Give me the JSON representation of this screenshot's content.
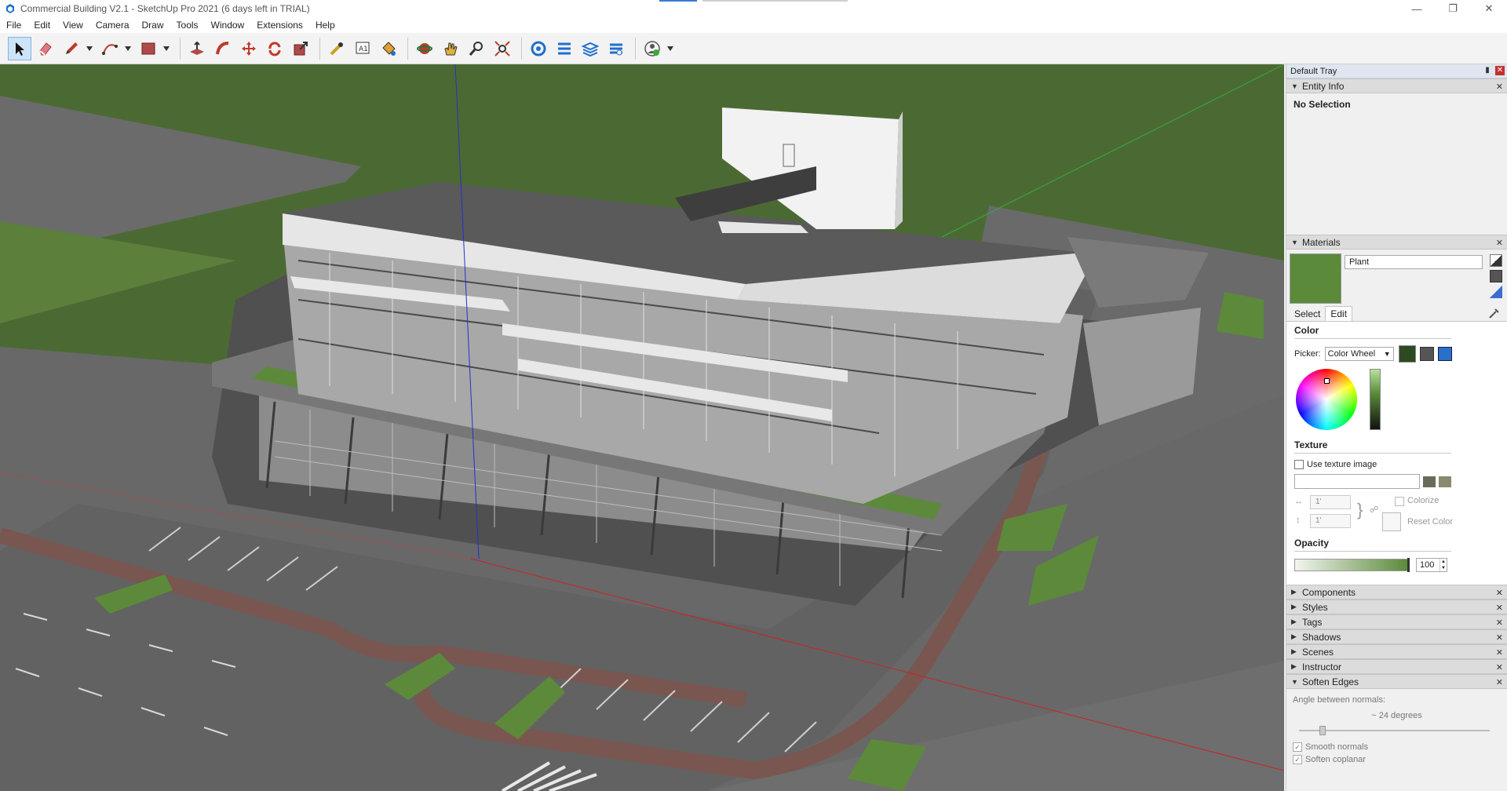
{
  "window": {
    "title": "Commercial Building V2.1 - SketchUp Pro 2021 (6 days left in TRIAL)",
    "controls": [
      "minimize",
      "restore",
      "close"
    ]
  },
  "menu": [
    "File",
    "Edit",
    "View",
    "Camera",
    "Draw",
    "Tools",
    "Window",
    "Extensions",
    "Help"
  ],
  "toolbar": {
    "tools": [
      "select",
      "eraser",
      "line",
      "arc",
      "rectangle",
      "push-pull",
      "follow-me",
      "move",
      "rotate",
      "scale",
      "tape-measure",
      "text",
      "paint-bucket",
      "orbit",
      "pan",
      "zoom",
      "zoom-extents",
      "warehouse",
      "extension-warehouse",
      "layout",
      "extension-manager",
      "profile"
    ]
  },
  "tray": {
    "title": "Default Tray",
    "entity_info": {
      "title": "Entity Info",
      "status": "No Selection"
    },
    "materials": {
      "title": "Materials",
      "name": "Plant",
      "swatch_color": "#5a8a3a",
      "tabs": [
        "Select",
        "Edit"
      ],
      "selected_tab": "Edit",
      "color_section": "Color",
      "picker_label": "Picker:",
      "picker_value": "Color Wheel",
      "texture_section": "Texture",
      "use_texture_label": "Use texture image",
      "width_value": "1'",
      "height_value": "1'",
      "colorize_label": "Colorize",
      "reset_color_label": "Reset Color",
      "opacity_section": "Opacity",
      "opacity_value": "100"
    },
    "collapsed_panels": [
      "Components",
      "Styles",
      "Tags",
      "Shadows",
      "Scenes",
      "Instructor"
    ],
    "soften": {
      "title": "Soften Edges",
      "angle_label": "Angle between normals:",
      "angle_value": "24",
      "angle_unit": "degrees",
      "smooth_label": "Smooth normals",
      "coplanar_label": "Soften coplanar"
    }
  }
}
